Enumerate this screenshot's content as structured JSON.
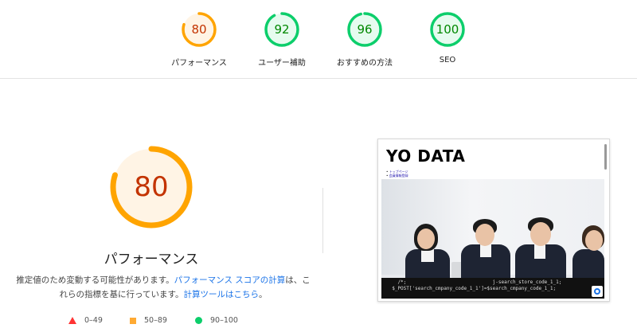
{
  "summary": [
    {
      "score": "80",
      "label": "パフォーマンス",
      "status": "average",
      "fraction": 0.8
    },
    {
      "score": "92",
      "label": "ユーザー補助",
      "status": "pass",
      "fraction": 0.92
    },
    {
      "score": "96",
      "label": "おすすめの方法",
      "status": "pass",
      "fraction": 0.96
    },
    {
      "score": "100",
      "label": "SEO",
      "status": "pass",
      "fraction": 1.0
    }
  ],
  "main": {
    "score": "80",
    "fraction": 0.8,
    "title": "パフォーマンス",
    "desc_pre": "推定値のため変動する可能性があります。",
    "desc_link1": "パフォーマンス スコアの計算",
    "desc_mid": "は、これらの指標を基に行っています。",
    "desc_link2": "計算ツールはこちら",
    "desc_post": "。"
  },
  "legend": {
    "fail": "0–49",
    "average": "50–89",
    "pass": "90–100"
  },
  "thumbnail": {
    "site_title": "YO DATA",
    "links": [
      "トップページ",
      "会員情報登録"
    ],
    "code_line1": "    /*;                              j-search_store_code_1_1;",
    "code_line2": "  $_POST['search_cmpany_code_1_1']=$search_cmpany_code_1_1;"
  },
  "colors": {
    "average": "#ffa400",
    "average_text": "#c33300",
    "pass": "#0cce6b",
    "pass_text": "#008800",
    "fail": "#ff3333",
    "link": "#1a73e8"
  }
}
